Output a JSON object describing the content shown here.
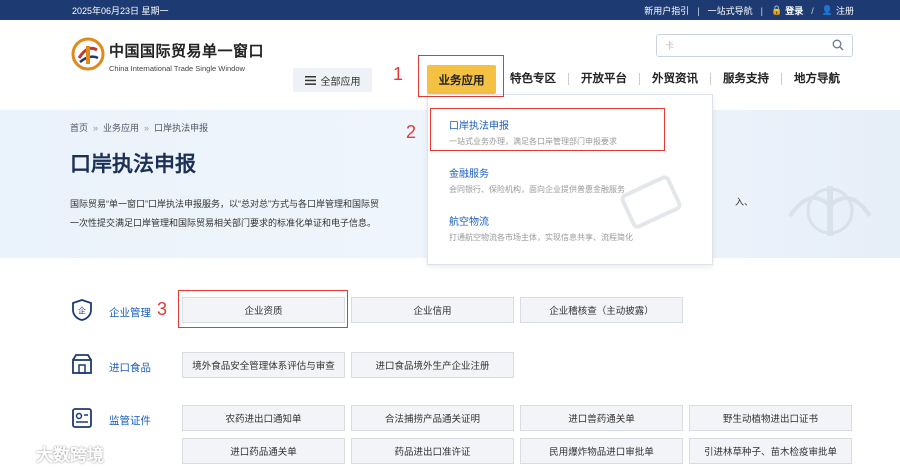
{
  "topbar": {
    "date": "2025年06月23日 星期一",
    "guide": "新用户指引",
    "nav": "一站式导航",
    "login": "登录",
    "register": "注册"
  },
  "header": {
    "logo_cn": "中国国际贸易单一窗口",
    "logo_en": "China International Trade Single Window",
    "search_placeholder": "卡",
    "all_apps": "全部应用",
    "nav": [
      "业务应用",
      "特色专区",
      "开放平台",
      "外贸资讯",
      "服务支持",
      "地方导航"
    ]
  },
  "breadcrumb": [
    "首页",
    "业务应用",
    "口岸执法申报"
  ],
  "page_title": "口岸执法申报",
  "intro": {
    "line1": "国际贸易“单一窗口”口岸执法申报服务，以“总对总”方式与各口岸管理和国际贸",
    "line1_tail": "入、",
    "line2": "一次性提交满足口岸管理和国际贸易相关部门要求的标准化单证和电子信息。"
  },
  "dropdown": [
    {
      "title": "口岸执法申报",
      "desc": "一站式业务办理，满足各口岸管理部门申报要求"
    },
    {
      "title": "金融服务",
      "desc": "会同银行、保险机构，面向企业提供普惠金融服务"
    },
    {
      "title": "航空物流",
      "desc": "打通航空物流各市场主体，实现信息共享、流程简化"
    }
  ],
  "annotations": [
    "1",
    "2",
    "3"
  ],
  "sections": [
    {
      "label": "企业管理",
      "buttons": [
        "企业资质",
        "企业信用",
        "企业稽核查（主动披露）"
      ]
    },
    {
      "label": "进口食品",
      "buttons": [
        "境外食品安全管理体系评估与审查",
        "进口食品境外生产企业注册"
      ]
    },
    {
      "label": "监管证件",
      "buttons": [
        "农药进出口通知单",
        "合法捕捞产品通关证明",
        "进口兽药通关单",
        "野生动植物进出口证书",
        "进口药品通关单",
        "药品进出口准许证",
        "民用爆炸物品进口审批单",
        "引进林草种子、苗木检疫审批单"
      ]
    }
  ],
  "watermark": "大数跨境",
  "colors": {
    "topbar": "#1d3a73",
    "accent": "#f5c142",
    "link": "#1c5fbf",
    "annotation": "#e53935"
  }
}
